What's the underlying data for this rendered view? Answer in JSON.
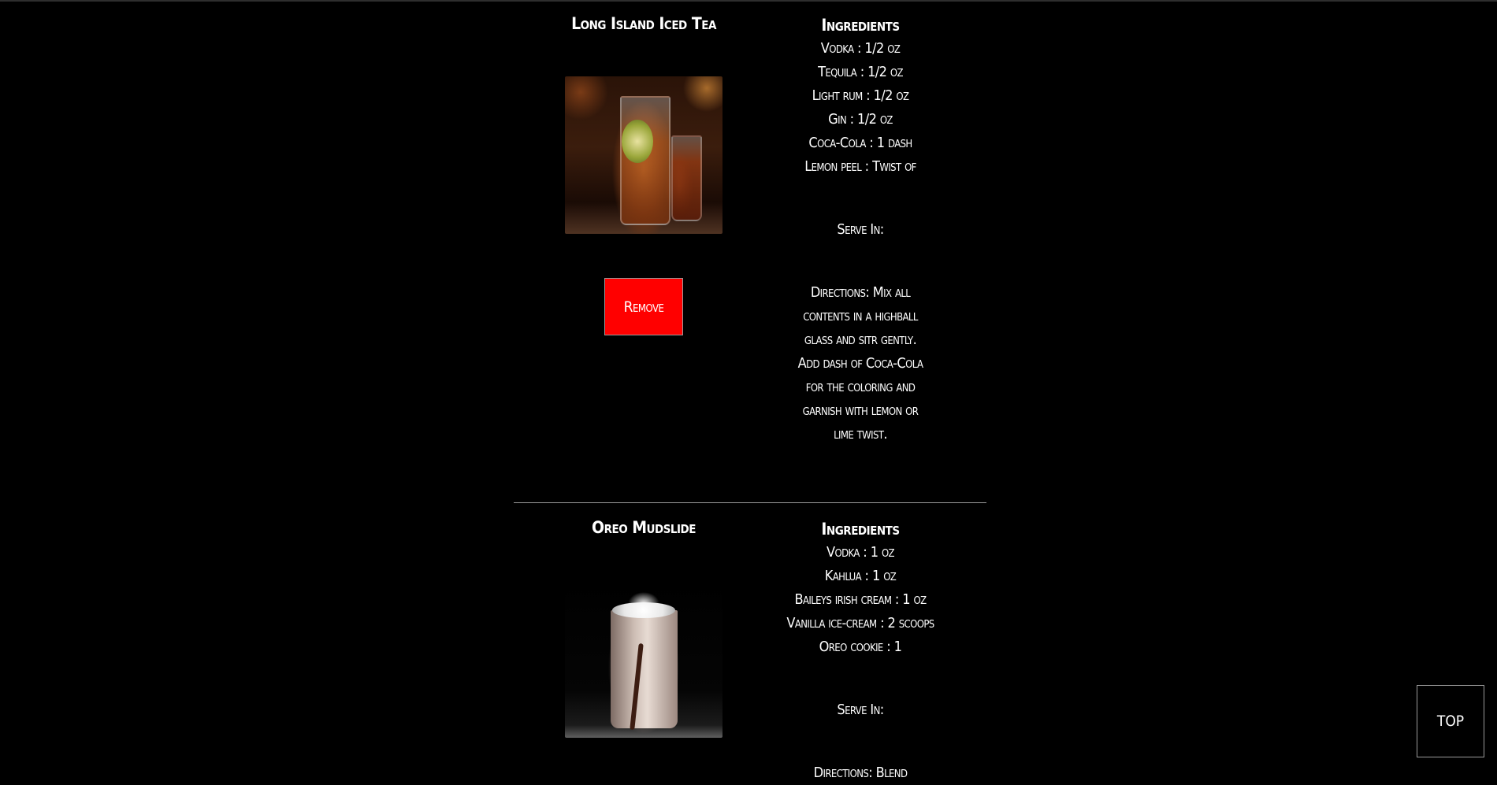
{
  "drinks": [
    {
      "name": "Long Island Iced Tea",
      "ingredients_heading": "Ingredients",
      "ingredients": [
        "Vodka : 1/2 oz",
        "Tequila : 1/2 oz",
        "Light rum : 1/2 oz",
        "Gin : 1/2 oz",
        "Coca-Cola : 1 dash",
        "Lemon peel : Twist of"
      ],
      "serve_in": "Serve In:",
      "directions_lines": [
        "Directions: Mix all",
        "contents in a highball",
        "glass and sitr gently.",
        "Add dash of Coca-Cola",
        "for the coloring and",
        "garnish with lemon or",
        "lime twist."
      ],
      "remove_label": "Remove"
    },
    {
      "name": "Oreo Mudslide",
      "ingredients_heading": "Ingredients",
      "ingredients": [
        "Vodka : 1 oz",
        "Kahlua : 1 oz",
        "Baileys irish cream : 1 oz",
        "Vanilla ice-cream : 2 scoops",
        "Oreo cookie : 1"
      ],
      "serve_in": "Serve In:",
      "directions_lines": [
        "Directions: Blend"
      ]
    }
  ],
  "top_button_label": "TOP"
}
